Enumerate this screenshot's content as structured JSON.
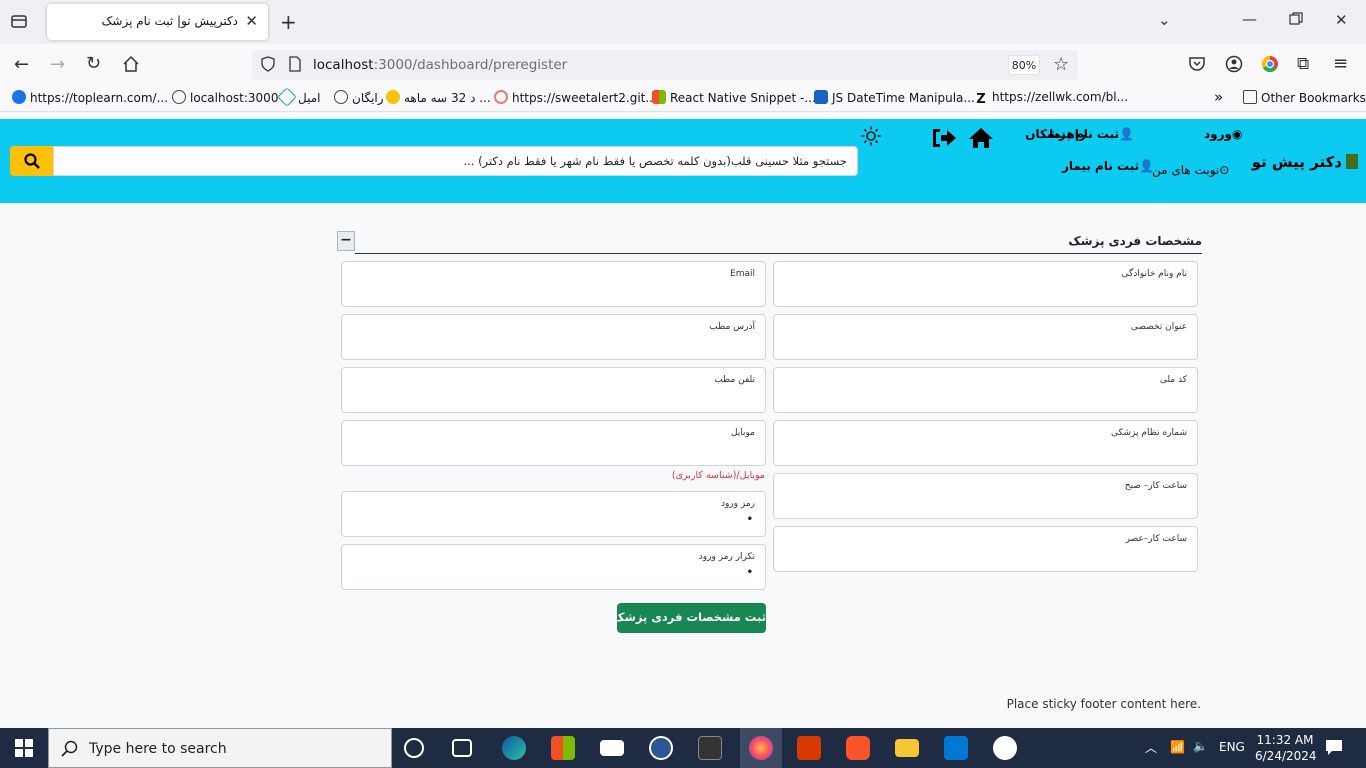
{
  "browser": {
    "tab_title": "دکترپیش تو| ثبت نام پزشک",
    "url_host": "localhost",
    "url_rest": ":3000/dashboard/preregister",
    "zoom": "80%",
    "bookmarks": [
      {
        "label": "https://toplearn.com/...",
        "color": "#1a73e8"
      },
      {
        "label": "localhost:3000",
        "color": "#444444"
      },
      {
        "label": "امیل",
        "color": "#1e88e5"
      },
      {
        "label": "رایگان",
        "color": "#444444"
      },
      {
        "label": "د 32 سه ماهه ...",
        "color": "#f4c20d"
      },
      {
        "label": "https://sweetalert2.git...",
        "color": "#e67e73"
      },
      {
        "label": "React Native Snippet -...",
        "color": "#f25022"
      },
      {
        "label": "JS DateTime Manipula...",
        "color": "#1565c0"
      },
      {
        "label": "https://zellwk.com/bl...",
        "color": "#111111"
      }
    ],
    "other_bookmarks": "Other Bookmarks"
  },
  "header": {
    "brand": "دکتر پیش تو",
    "nav": {
      "login": "ورود",
      "doctor_register": "ثبت نام پزشکان",
      "guide": "راهنما",
      "my_appointments": "نوبت های من",
      "patient_register": "ثبت نام بیمار"
    },
    "search_placeholder": "جستجو مثلا حسینی قلب(بدون کلمه تخصص یا فقط نام شهر یا فقط نام دکتر) ...",
    "accent": "#0dcaf0",
    "search_button_color": "#ffc107"
  },
  "form": {
    "section_title": "مشخصات فردی پزشک",
    "collapse_symbol": "−",
    "right_fields": [
      {
        "label": "نام ونام خانوادگی"
      },
      {
        "label": "عنوان تخصصی"
      },
      {
        "label": "کد ملی"
      },
      {
        "label": "شماره نظام پزشکی"
      },
      {
        "label": "ساعت کار– صبح"
      },
      {
        "label": "ساعت کار–عصر"
      }
    ],
    "left_fields": [
      {
        "label": "Email",
        "value": ""
      },
      {
        "label": "آدرس مطب",
        "value": ""
      },
      {
        "label": "تلفن مطب",
        "value": ""
      },
      {
        "label": "موبایل",
        "value": ""
      }
    ],
    "mobile_hint": "موبایل/(شناسه کاربری)",
    "password_label": "رمز ورود",
    "password_value": "•",
    "confirm_label": "تکرار رمز ورود",
    "confirm_value": "•",
    "submit": "ثبت مشخصات فردی پزشک",
    "submit_color": "#198754"
  },
  "footer": {
    "text": "Place sticky footer content here."
  },
  "taskbar": {
    "search_placeholder": "Type here to search",
    "lang": "ENG",
    "time": "11:32 AM",
    "date": "6/24/2024"
  }
}
